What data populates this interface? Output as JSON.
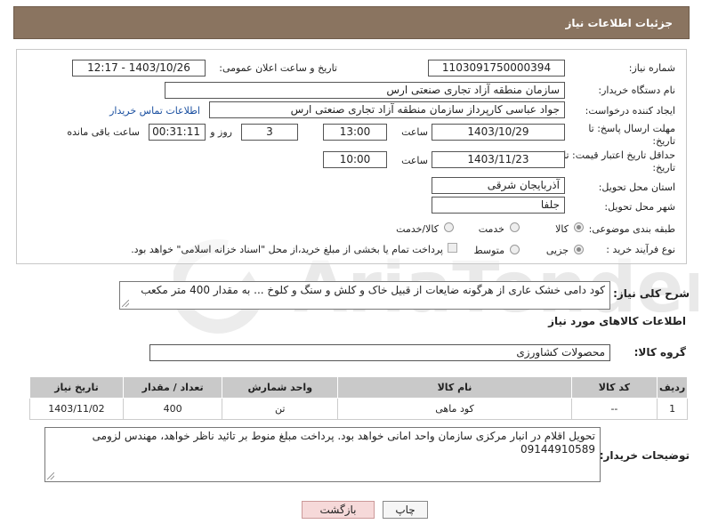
{
  "page": {
    "title": "جزئیات اطلاعات نیاز"
  },
  "form": {
    "need_number_label": "شماره نیاز:",
    "need_number": "1103091750000394",
    "announce_label": "تاریخ و ساعت اعلان عمومی:",
    "announce_value": "1403/10/26 - 12:17",
    "buyer_org_label": "نام دستگاه خریدار:",
    "buyer_org": "سازمان منطقه آزاد تجاری صنعتی ارس",
    "creator_label": "ایجاد کننده درخواست:",
    "creator": "جواد عباسی کارپرداز سازمان منطقه آزاد تجاری صنعتی ارس",
    "contact_link": "اطلاعات تماس خریدار",
    "deadline_label_1": "مهلت ارسال پاسخ: تا",
    "deadline_label_2": "تاریخ:",
    "deadline_date": "1403/10/29",
    "time_label": "ساعت",
    "deadline_time": "13:00",
    "days_value": "3",
    "days_label": "روز و",
    "remaining_time": "00:31:11",
    "remaining_label": "ساعت باقی مانده",
    "validity_label_1": "حداقل تاریخ اعتبار قیمت: تا",
    "validity_label_2": "تاریخ:",
    "validity_date": "1403/11/23",
    "validity_time": "10:00",
    "province_label": "استان محل تحویل:",
    "province": "آذربایجان شرقی",
    "city_label": "شهر محل تحویل:",
    "city": "جلفا",
    "category_label": "طبقه بندی موضوعی:",
    "category_options": [
      "کالا",
      "خدمت",
      "کالا/خدمت"
    ],
    "process_label": "نوع فرآیند خرید :",
    "process_options": [
      "جزیی",
      "متوسط"
    ],
    "payment_note": "پرداخت تمام یا بخشی از مبلغ خرید،از محل \"اسناد خزانه اسلامی\" خواهد بود."
  },
  "summary": {
    "label": "شرح کلی نیاز:",
    "text": "کود دامی خشک عاری از هرگونه ضایعات از قبیل خاک و کلش و سنگ و کلوخ ... به مقدار 400 متر مکعب"
  },
  "goods": {
    "section_title": "اطلاعات کالاهای مورد نیاز",
    "group_label": "گروه کالا:",
    "group_value": "محصولات کشاورزی",
    "columns": [
      "ردیف",
      "کد کالا",
      "نام کالا",
      "واحد شمارش",
      "تعداد / مقدار",
      "تاریخ نیاز"
    ],
    "rows": [
      [
        "1",
        "--",
        "کود ماهی",
        "تن",
        "400",
        "1403/11/02"
      ]
    ]
  },
  "buyer_notes": {
    "label": "توضیحات خریدار:",
    "line1": "تحویل اقلام در انبار مرکزی سازمان واحد امانی خواهد بود. پرداخت مبلغ منوط بر تائید ناظر خواهد، مهندس لزومی",
    "line2": "09144910589"
  },
  "buttons": {
    "print": "چاپ",
    "back": "بازگشت"
  },
  "watermark": {
    "text": "AriaTender.neT"
  },
  "colors": {
    "header_bg": "#8a7460",
    "table_header_bg": "#c9c9c9",
    "back_button_bg": "#f6d9d9",
    "link": "#1a4fa0"
  }
}
